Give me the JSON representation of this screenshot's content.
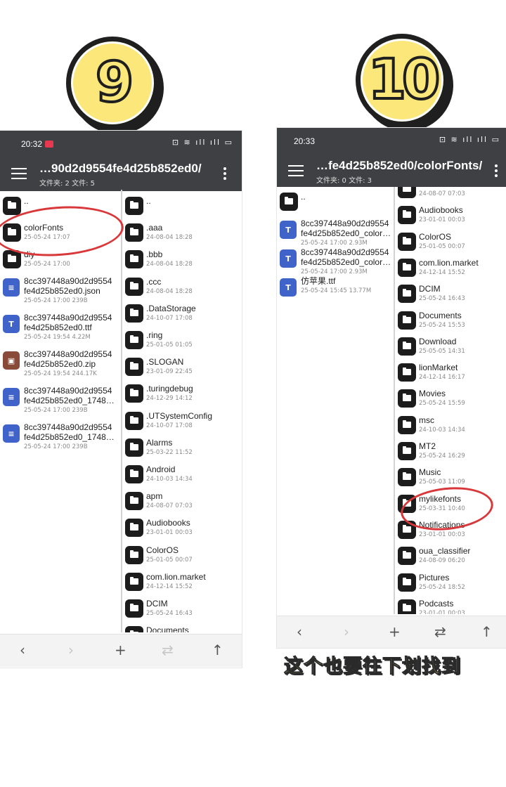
{
  "steps": {
    "left": "9",
    "right": "10"
  },
  "caption": "这个也要往下划找到",
  "phone_left": {
    "time": "20:32",
    "status_icons": "⊡ ≋ ıll ıll ▭",
    "path": "…90d2d9554fe4d25b852ed0/",
    "counts": "文件夹: 2  文件: 5",
    "left_pane": [
      {
        "kind": "folder",
        "name": "..",
        "meta": ""
      },
      {
        "kind": "folder",
        "name": "colorFonts",
        "meta": "25-05-24 17:07"
      },
      {
        "kind": "folder",
        "name": "diy",
        "meta": "25-05-24 17:00"
      },
      {
        "kind": "doc",
        "name": "8cc397448a90d2d9554",
        "name2": "fe4d25b852ed0.json",
        "meta": "25-05-24 17:00  239B"
      },
      {
        "kind": "font",
        "name": "8cc397448a90d2d9554",
        "name2": "fe4d25b852ed0.ttf",
        "meta": "25-05-24 19:54  4.22M"
      },
      {
        "kind": "zip",
        "name": "8cc397448a90d2d9554",
        "name2": "fe4d25b852ed0.zip",
        "meta": "25-05-24 19:54  244.17K"
      },
      {
        "kind": "doc",
        "name": "8cc397448a90d2d9554",
        "name2": "fe4d25b852ed0_1748…",
        "meta": "25-05-24 17:00  239B"
      },
      {
        "kind": "doc",
        "name": "8cc397448a90d2d9554",
        "name2": "fe4d25b852ed0_1748…",
        "meta": "25-05-24 17:00  239B"
      }
    ],
    "right_pane": [
      {
        "name": "..",
        "meta": ""
      },
      {
        "name": ".aaa",
        "meta": "24-08-04 18:28"
      },
      {
        "name": ".bbb",
        "meta": "24-08-04 18:28"
      },
      {
        "name": ".ccc",
        "meta": "24-08-04 18:28"
      },
      {
        "name": ".DataStorage",
        "meta": "24-10-07 17:08"
      },
      {
        "name": ".ring",
        "meta": "25-01-05 01:05"
      },
      {
        "name": ".SLOGAN",
        "meta": "23-01-09 22:45"
      },
      {
        "name": ".turingdebug",
        "meta": "24-12-29 14:12"
      },
      {
        "name": ".UTSystemConfig",
        "meta": "24-10-07 17:08"
      },
      {
        "name": "Alarms",
        "meta": "25-03-22 11:52"
      },
      {
        "name": "Android",
        "meta": "24-10-03 14:34"
      },
      {
        "name": "apm",
        "meta": "24-08-07 07:03"
      },
      {
        "name": "Audiobooks",
        "meta": "23-01-01 00:03"
      },
      {
        "name": "ColorOS",
        "meta": "25-01-05 00:07"
      },
      {
        "name": "com.lion.market",
        "meta": "24-12-14 15:52"
      },
      {
        "name": "DCIM",
        "meta": "25-05-24 16:43"
      },
      {
        "name": "Documents",
        "meta": ""
      }
    ]
  },
  "phone_right": {
    "time": "20:33",
    "status_icons": "⊡ ≋ ıll ıll ▭",
    "path": "…fe4d25b852ed0/colorFonts/",
    "counts": "文件夹: 0  文件: 3",
    "left_pane": [
      {
        "kind": "folder",
        "name": "..",
        "meta": ""
      },
      {
        "kind": "font",
        "name": "8cc397448a90d2d9554",
        "name2": "fe4d25b852ed0_color…",
        "meta": "25-05-24 17:00  2.93M"
      },
      {
        "kind": "font",
        "name": "8cc397448a90d2d9554",
        "name2": "fe4d25b852ed0_color…",
        "meta": "25-05-24 17:00  2.93M"
      },
      {
        "kind": "font",
        "name": "仿苹果.ttf",
        "meta": "25-05-24 15:45  13.77M"
      }
    ],
    "right_pane": [
      {
        "name": "",
        "meta": "24-08-07 07:03"
      },
      {
        "name": "Audiobooks",
        "meta": "23-01-01 00:03"
      },
      {
        "name": "ColorOS",
        "meta": "25-01-05 00:07"
      },
      {
        "name": "com.lion.market",
        "meta": "24-12-14 15:52"
      },
      {
        "name": "DCIM",
        "meta": "25-05-24 16:43"
      },
      {
        "name": "Documents",
        "meta": "25-05-24 15:53"
      },
      {
        "name": "Download",
        "meta": "25-05-05 14:31"
      },
      {
        "name": "lionMarket",
        "meta": "24-12-14 16:17"
      },
      {
        "name": "Movies",
        "meta": "25-05-24 15:59"
      },
      {
        "name": "msc",
        "meta": "24-10-03 14:34"
      },
      {
        "name": "MT2",
        "meta": "25-05-24 16:29"
      },
      {
        "name": "Music",
        "meta": "25-05-03 11:09"
      },
      {
        "name": "mylikefonts",
        "meta": "25-03-31 10:40"
      },
      {
        "name": "Notifications",
        "meta": "23-01-01 00:03"
      },
      {
        "name": "oua_classifier",
        "meta": "24-08-09 06:20"
      },
      {
        "name": "Pictures",
        "meta": "25-05-24 18:52"
      },
      {
        "name": "Podcasts",
        "meta": "23-01-01 00:03"
      }
    ]
  },
  "bottom_icons": {
    "back": "‹",
    "forward": "›",
    "add": "+",
    "swap": "⇄",
    "up": "↑"
  },
  "colors": {
    "topbar": "#3f4043",
    "doc_icon": "#3f63c9",
    "font_icon": "#3f63c9",
    "zip_icon": "#8a4a3a",
    "annotation": "#d9383a",
    "badge": "#fbe77a"
  }
}
